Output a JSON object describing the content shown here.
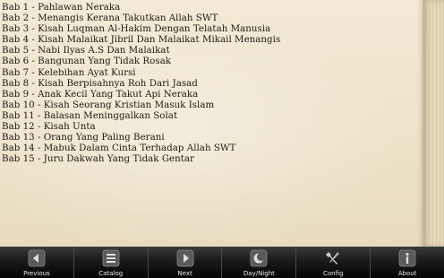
{
  "chapters": [
    "Bab 1 - Pahlawan Neraka",
    "Bab 2 - Menangis Kerana Takutkan Allah SWT",
    "Bab 3 - Kisah Luqman Al-Hakim Dengan Telatah Manusia",
    "Bab 4 - Kisah Malaikat Jibril Dan Malaikat Mikail Menangis",
    "Bab 5 - Nabi Ilyas A.S Dan Malaikat",
    "Bab 6 - Bangunan Yang Tidak Rosak",
    "Bab 7 - Kelebihan Ayat Kursi",
    "Bab 8 - Kisah Berpisahnya Roh Dari Jasad",
    "Bab 9 - Anak Kecil Yang Takut Api Neraka",
    "Bab 10 - Kisah Seorang Kristian Masuk Islam",
    "Bab 11 - Balasan Meninggalkan Solat",
    "Bab 12 - Kisah Unta",
    "Bab 13 - Orang Yang Paling Berani",
    "Bab 14 - Mabuk Dalam Cinta Terhadap Allah SWT",
    "Bab 15 - Juru Dakwah Yang Tidak Gentar"
  ],
  "toolbar": {
    "previous": "Previous",
    "catalog": "Catalog",
    "next": "Next",
    "daynight": "Day/Night",
    "config": "Config",
    "about": "About"
  },
  "icons": {
    "previous": "arrow-left-icon",
    "catalog": "list-icon",
    "next": "arrow-right-icon",
    "daynight": "moon-icon",
    "config": "tools-icon",
    "about": "info-icon"
  },
  "colors": {
    "paper": "#ece2c8",
    "text": "#1e1a14",
    "toolbar": "#1a1a1a"
  }
}
